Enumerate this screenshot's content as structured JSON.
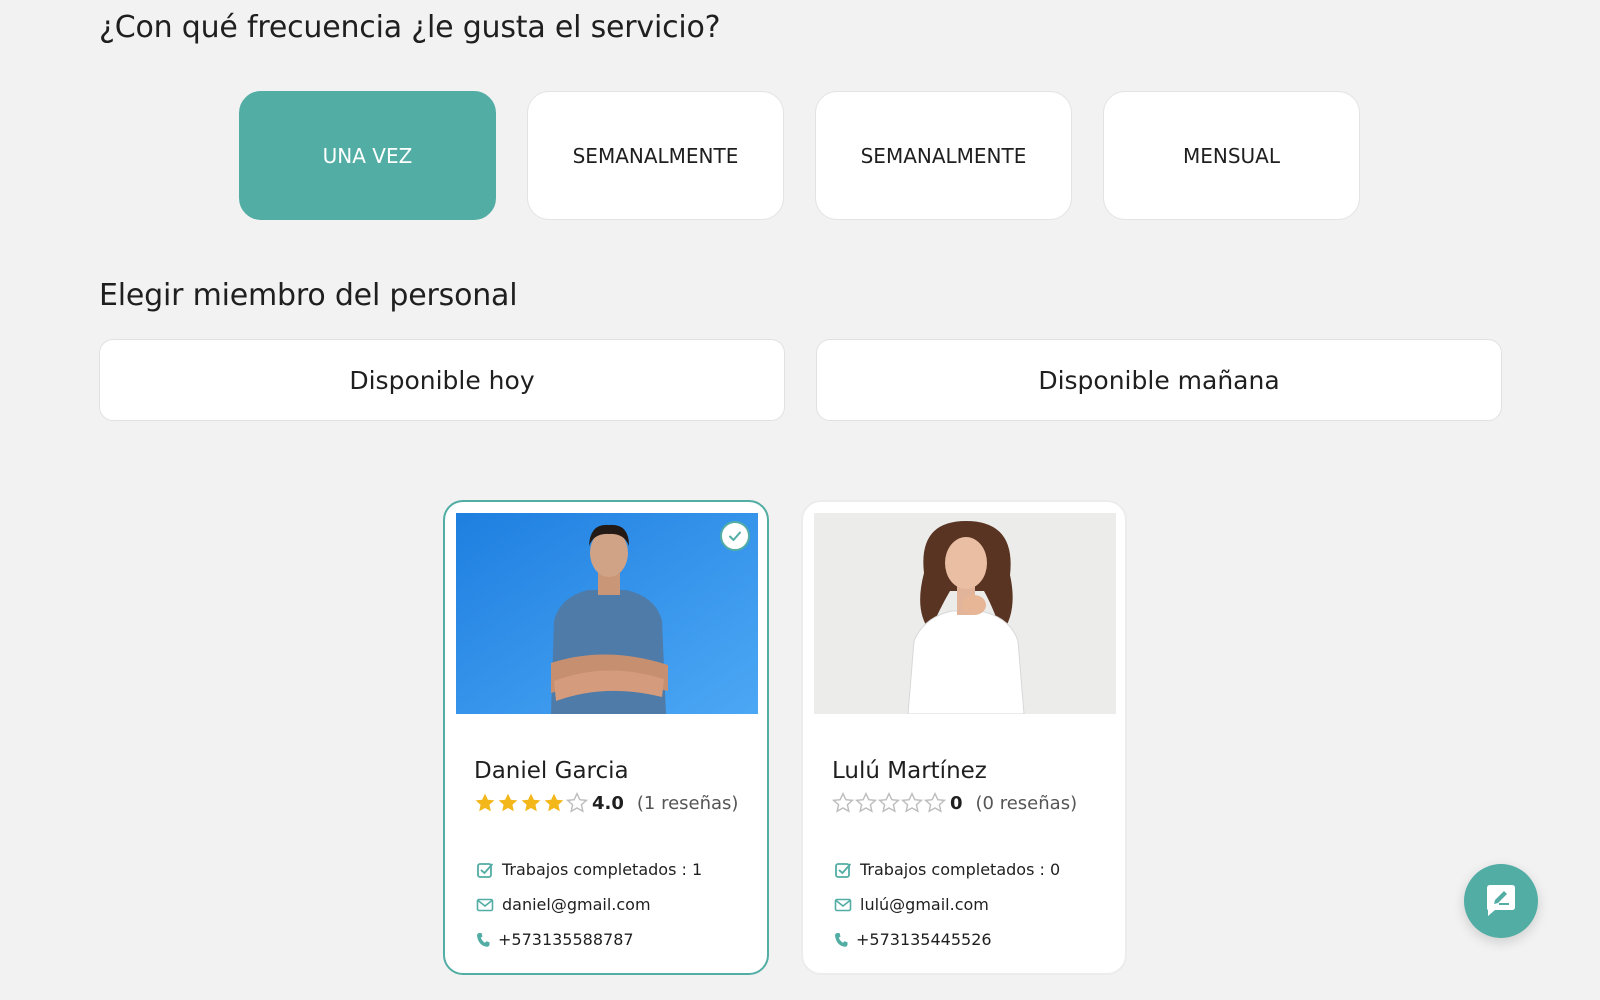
{
  "frequency": {
    "title": "¿Con qué frecuencia ¿le gusta el servicio?",
    "options": [
      "UNA VEZ",
      "SEMANALMENTE",
      "SEMANALMENTE",
      "MENSUAL"
    ],
    "selected": "UNA VEZ"
  },
  "staff_section": {
    "title": "Elegir miembro del personal",
    "tabs": [
      "Disponible hoy",
      "Disponible mañana"
    ]
  },
  "staff": [
    {
      "name": "Daniel Garcia",
      "rating": 4,
      "rating_label": "4.0",
      "reviews_label": "(1 reseñas)",
      "jobs_label": "Trabajos completados : 1",
      "email": "daniel@gmail.com",
      "phone": "+573135588787",
      "selected": true
    },
    {
      "name": "Lulú Martínez",
      "rating": 0,
      "rating_label": "0",
      "reviews_label": "(0 reseñas)",
      "jobs_label": "Trabajos completados : 0",
      "email": "lulú@gmail.com",
      "phone": "+573135445526",
      "selected": false
    }
  ],
  "colors": {
    "accent": "#52ada4",
    "star_filled": "#f4b71a",
    "star_empty": "#bdbdbd",
    "background": "#f2f2f2"
  },
  "icons": {
    "check": "check-icon",
    "jobs": "checkbox-icon",
    "email": "envelope-icon",
    "phone": "phone-icon",
    "chat": "chat-feedback-icon"
  }
}
